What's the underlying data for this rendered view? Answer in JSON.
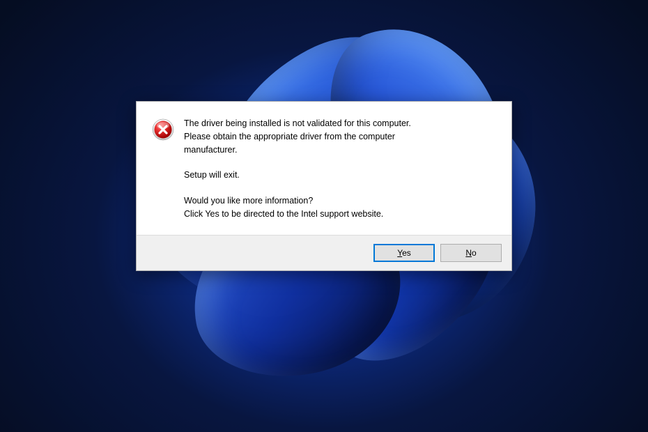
{
  "dialog": {
    "icon": "error-icon",
    "message": {
      "line1": "The driver being installed is not validated for this computer.",
      "line2": "Please obtain the appropriate driver from the computer",
      "line3": "manufacturer.",
      "line4": "Setup will exit.",
      "line5": "Would you like more information?",
      "line6": "Click Yes to be directed to the Intel support website."
    },
    "buttons": {
      "yes": {
        "mnemonic": "Y",
        "rest": "es"
      },
      "no": {
        "mnemonic": "N",
        "rest": "o"
      }
    }
  }
}
